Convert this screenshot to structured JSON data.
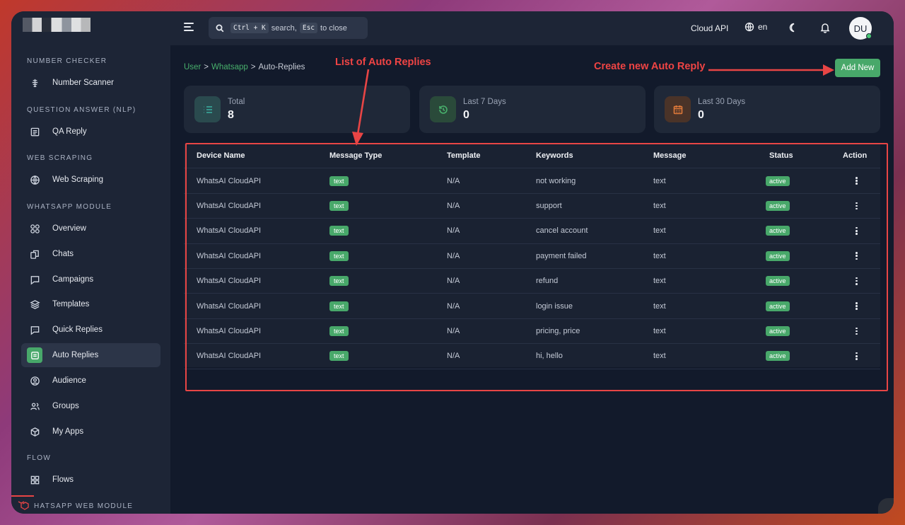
{
  "brand": {
    "accent": "#48a86a",
    "annotation": "#ef4444"
  },
  "topbar": {
    "search_kbd1": "Ctrl + K",
    "search_mid": "search,",
    "search_kbd2": "Esc",
    "search_end": "to close",
    "cloud_api": "Cloud API",
    "lang": "en",
    "avatar": "DU"
  },
  "sidebar": {
    "sections": {
      "number_checker": "NUMBER CHECKER",
      "qa": "QUESTION ANSWER (NLP)",
      "scraping": "WEB SCRAPING",
      "whatsapp": "WHATSAPP MODULE",
      "flow": "FLOW",
      "web_module": "HATSAPP WEB MODULE"
    },
    "items": {
      "number_scanner": "Number Scanner",
      "qa_reply": "QA Reply",
      "web_scraping": "Web Scraping",
      "overview": "Overview",
      "chats": "Chats",
      "campaigns": "Campaigns",
      "templates": "Templates",
      "quick_replies": "Quick Replies",
      "auto_replies": "Auto Replies",
      "audience": "Audience",
      "groups": "Groups",
      "my_apps": "My Apps",
      "flows": "Flows"
    }
  },
  "breadcrumb": {
    "user": "User",
    "whatsapp": "Whatsapp",
    "current": "Auto-Replies",
    "sep": ">"
  },
  "add_button": "Add New",
  "stats": [
    {
      "label": "Total",
      "value": "8",
      "color": "#3a8f87"
    },
    {
      "label": "Last 7 Days",
      "value": "0",
      "color": "#48b06c"
    },
    {
      "label": "Last 30 Days",
      "value": "0",
      "color": "#e07a3a"
    }
  ],
  "table": {
    "headers": [
      "Device Name",
      "Message Type",
      "Template",
      "Keywords",
      "Message",
      "Status",
      "Action"
    ],
    "rows": [
      {
        "device": "WhatsAI CloudAPI",
        "type": "text",
        "template": "N/A",
        "keywords": "not working",
        "message": "text",
        "status": "active"
      },
      {
        "device": "WhatsAI CloudAPI",
        "type": "text",
        "template": "N/A",
        "keywords": "support",
        "message": "text",
        "status": "active"
      },
      {
        "device": "WhatsAI CloudAPI",
        "type": "text",
        "template": "N/A",
        "keywords": "cancel account",
        "message": "text",
        "status": "active"
      },
      {
        "device": "WhatsAI CloudAPI",
        "type": "text",
        "template": "N/A",
        "keywords": "payment failed",
        "message": "text",
        "status": "active"
      },
      {
        "device": "WhatsAI CloudAPI",
        "type": "text",
        "template": "N/A",
        "keywords": "refund",
        "message": "text",
        "status": "active"
      },
      {
        "device": "WhatsAI CloudAPI",
        "type": "text",
        "template": "N/A",
        "keywords": "login issue",
        "message": "text",
        "status": "active"
      },
      {
        "device": "WhatsAI CloudAPI",
        "type": "text",
        "template": "N/A",
        "keywords": "pricing, price",
        "message": "text",
        "status": "active"
      },
      {
        "device": "WhatsAI CloudAPI",
        "type": "text",
        "template": "N/A",
        "keywords": "hi, hello",
        "message": "text",
        "status": "active"
      }
    ]
  },
  "annotations": {
    "list": "List of Auto Replies",
    "create": "Create new Auto Reply"
  }
}
